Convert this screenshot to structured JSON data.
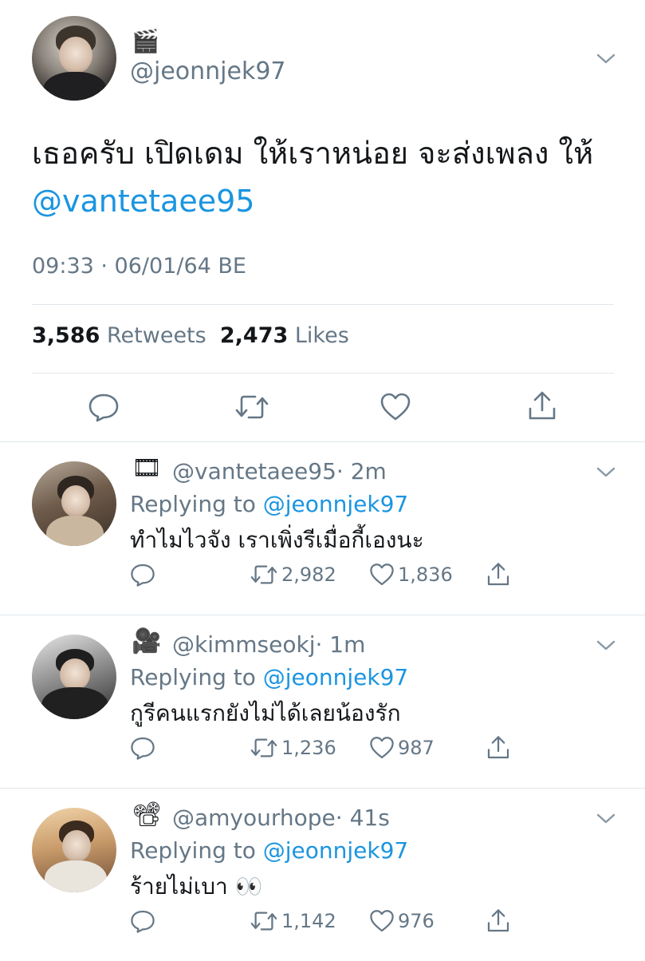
{
  "main_tweet": {
    "emoji": "🎬",
    "handle": "@jeonnjek97",
    "text": "เธอครับ เปิดเดม ให้เราหน่อย จะส่งเพลง ให้",
    "mention": "@vantetaee95",
    "timestamp": "09:33 · 06/01/64 BE",
    "retweets_count": "3,586",
    "retweets_label": "Retweets",
    "likes_count": "2,473",
    "likes_label": "Likes"
  },
  "replies": [
    {
      "emoji": "🎞",
      "handle": "@vantetaee95",
      "time": "· 2m",
      "replying_prefix": "Replying to",
      "replying_to": "@jeonnjek97",
      "text": "ทำไมไวจัง เราเพิ่งรีเมื่อกี้เองนะ",
      "retweets": "2,982",
      "likes": "1,836"
    },
    {
      "emoji": "🎥",
      "handle": "@kimmseokj",
      "time": "· 1m",
      "replying_prefix": "Replying to",
      "replying_to": "@jeonnjek97",
      "text": "กูรีคนแรกยังไม่ได้เลยน้องรัก",
      "retweets": "1,236",
      "likes": "987"
    },
    {
      "emoji": "📽",
      "handle": "@amyourhope",
      "time": "· 41s",
      "replying_prefix": "Replying to",
      "replying_to": "@jeonnjek97",
      "text": "ร้ายไม่เบา 👀",
      "retweets": "1,142",
      "likes": "976"
    }
  ],
  "icons": [
    "reply-icon",
    "retweet-icon",
    "like-icon",
    "share-icon",
    "chevron-down-icon"
  ],
  "colors": {
    "link": "#1b95e0",
    "secondary": "#657786",
    "divider": "#e1e8ed"
  }
}
